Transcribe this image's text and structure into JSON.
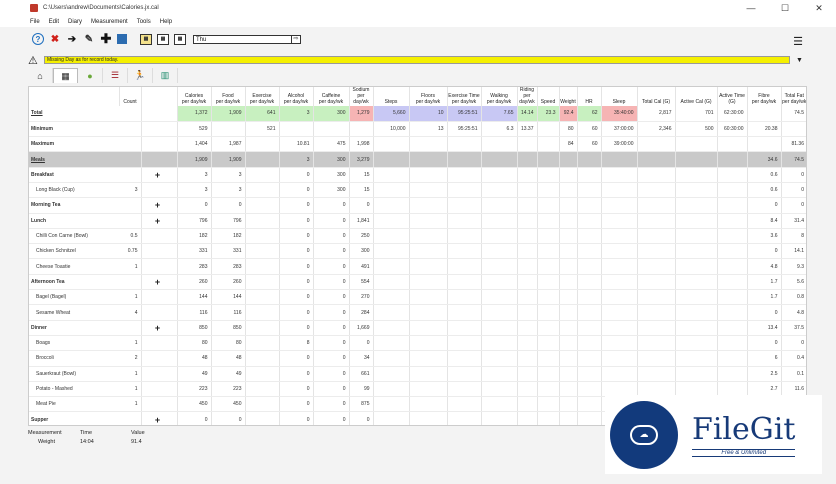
{
  "window": {
    "title": "C:\\Users\\andrew\\Documents\\Calories.jx.cal",
    "minimize": "—",
    "maximize": "☐",
    "close": "✕"
  },
  "menu": [
    "File",
    "Edit",
    "Diary",
    "Measurement",
    "Tools",
    "Help"
  ],
  "toolbar": {
    "day_value": "Thu",
    "go": "⇨",
    "cal1": "▦",
    "cal2": "▦",
    "cal3": "▦"
  },
  "warning": {
    "message": "Missing Day as for record today."
  },
  "tabs": [
    "⌂",
    "▦",
    "●",
    "☰",
    "🏃",
    "▥"
  ],
  "columns": [
    {
      "top": "Calories",
      "bot": "per day/wk"
    },
    {
      "top": "Food",
      "bot": "per day/wk"
    },
    {
      "top": "Exercise",
      "bot": "per day/wk"
    },
    {
      "top": "Alcohol",
      "bot": "per day/wk"
    },
    {
      "top": "Caffeine",
      "bot": "per day/wk"
    },
    {
      "top": "Sodium",
      "bot": "per day/wk"
    },
    {
      "top": "Steps",
      "bot": ""
    },
    {
      "top": "Floors",
      "bot": "per day/wk"
    },
    {
      "top": "Exercise Time",
      "bot": "per day/wk"
    },
    {
      "top": "Walking",
      "bot": "per day/wk"
    },
    {
      "top": "Riding",
      "bot": "per day/wk"
    },
    {
      "top": "Speed",
      "bot": ""
    },
    {
      "top": "Weight",
      "bot": ""
    },
    {
      "top": "HR",
      "bot": ""
    },
    {
      "top": "Sleep",
      "bot": ""
    },
    {
      "top": "Total Cal (G)",
      "bot": ""
    },
    {
      "top": "Active Cal (G)",
      "bot": ""
    },
    {
      "top": "Active Time (G)",
      "bot": ""
    },
    {
      "top": "Fibre",
      "bot": "per day/wk"
    },
    {
      "top": "Total Fat",
      "bot": "per day/wk"
    }
  ],
  "count_header": "Count",
  "rows": [
    {
      "type": "total",
      "label": "Total",
      "count": "",
      "plus": "",
      "vals": [
        "1,372",
        "1,909",
        "641",
        "3",
        "300",
        "1,279",
        "5,660",
        "10",
        "95:25:51",
        "7.65",
        "14.14",
        "23.3",
        "92.4",
        "62",
        "35:40:00",
        "2,817",
        "701",
        "62:30:00",
        "",
        "74.5"
      ],
      "hi": [
        "g",
        "g",
        "g",
        "g",
        "g",
        "r",
        "p",
        "p",
        "p",
        "p",
        "g",
        "g",
        "r",
        "g",
        "r",
        "",
        "",
        "",
        "",
        ""
      ]
    },
    {
      "type": "min",
      "label": "Minimum",
      "count": "",
      "plus": "",
      "vals": [
        "529",
        "",
        "521",
        "",
        "",
        "",
        "10,000",
        "13",
        "95:25:51",
        "6.3",
        "13.37",
        "",
        "80",
        "60",
        "37:00:00",
        "2,346",
        "500",
        "60:30:00",
        "20.38",
        ""
      ]
    },
    {
      "type": "max",
      "label": "Maximum",
      "count": "",
      "plus": "",
      "vals": [
        "1,404",
        "1,987",
        "",
        "10.81",
        "475",
        "1,998",
        "",
        "",
        "",
        "",
        "",
        "",
        "84",
        "60",
        "39:00:00",
        "",
        "",
        "",
        "",
        "81.36"
      ]
    },
    {
      "type": "meals",
      "label": "Meals",
      "count": "",
      "plus": "",
      "vals": [
        "1,909",
        "1,909",
        "",
        "3",
        "300",
        "3,279",
        "",
        "",
        "",
        "",
        "",
        "",
        "",
        "",
        "",
        "",
        "",
        "",
        "34.6",
        "74.5"
      ]
    },
    {
      "type": "sec",
      "label": "Breakfast",
      "count": "",
      "plus": "+",
      "vals": [
        "3",
        "3",
        "",
        "0",
        "300",
        "15",
        "",
        "",
        "",
        "",
        "",
        "",
        "",
        "",
        "",
        "",
        "",
        "",
        "0.6",
        "0"
      ]
    },
    {
      "type": "item",
      "label": "Long Black (Cup)",
      "count": "3",
      "plus": "",
      "vals": [
        "3",
        "3",
        "",
        "0",
        "300",
        "15",
        "",
        "",
        "",
        "",
        "",
        "",
        "",
        "",
        "",
        "",
        "",
        "",
        "0.6",
        "0"
      ]
    },
    {
      "type": "sec",
      "label": "Morning Tea",
      "count": "",
      "plus": "+",
      "vals": [
        "0",
        "0",
        "",
        "0",
        "0",
        "0",
        "",
        "",
        "",
        "",
        "",
        "",
        "",
        "",
        "",
        "",
        "",
        "",
        "0",
        "0"
      ]
    },
    {
      "type": "sec",
      "label": "Lunch",
      "count": "",
      "plus": "+",
      "vals": [
        "796",
        "796",
        "",
        "0",
        "0",
        "1,841",
        "",
        "",
        "",
        "",
        "",
        "",
        "",
        "",
        "",
        "",
        "",
        "",
        "8.4",
        "31.4"
      ]
    },
    {
      "type": "item",
      "label": "Chilli Con Carne (Bowl)",
      "count": "0.5",
      "plus": "",
      "vals": [
        "182",
        "182",
        "",
        "0",
        "0",
        "250",
        "",
        "",
        "",
        "",
        "",
        "",
        "",
        "",
        "",
        "",
        "",
        "",
        "3.6",
        "8"
      ]
    },
    {
      "type": "item",
      "label": "Chicken Schnitzel",
      "count": "0.75",
      "plus": "",
      "vals": [
        "331",
        "331",
        "",
        "0",
        "0",
        "300",
        "",
        "",
        "",
        "",
        "",
        "",
        "",
        "",
        "",
        "",
        "",
        "",
        "0",
        "14.1"
      ]
    },
    {
      "type": "item",
      "label": "Cheese Toastie",
      "count": "1",
      "plus": "",
      "vals": [
        "283",
        "283",
        "",
        "0",
        "0",
        "491",
        "",
        "",
        "",
        "",
        "",
        "",
        "",
        "",
        "",
        "",
        "",
        "",
        "4.8",
        "9.3"
      ]
    },
    {
      "type": "sec",
      "label": "Afternoon Tea",
      "count": "",
      "plus": "+",
      "vals": [
        "260",
        "260",
        "",
        "0",
        "0",
        "554",
        "",
        "",
        "",
        "",
        "",
        "",
        "",
        "",
        "",
        "",
        "",
        "",
        "1.7",
        "5.6"
      ]
    },
    {
      "type": "item",
      "label": "Bagel (Bagel)",
      "count": "1",
      "plus": "",
      "vals": [
        "144",
        "144",
        "",
        "0",
        "0",
        "270",
        "",
        "",
        "",
        "",
        "",
        "",
        "",
        "",
        "",
        "",
        "",
        "",
        "1.7",
        "0.8"
      ]
    },
    {
      "type": "item",
      "label": "Sesame Wheat",
      "count": "4",
      "plus": "",
      "vals": [
        "116",
        "116",
        "",
        "0",
        "0",
        "284",
        "",
        "",
        "",
        "",
        "",
        "",
        "",
        "",
        "",
        "",
        "",
        "",
        "0",
        "4.8"
      ]
    },
    {
      "type": "sec",
      "label": "Dinner",
      "count": "",
      "plus": "+",
      "vals": [
        "850",
        "850",
        "",
        "0",
        "0",
        "1,669",
        "",
        "",
        "",
        "",
        "",
        "",
        "",
        "",
        "",
        "",
        "",
        "",
        "13.4",
        "37.5"
      ]
    },
    {
      "type": "item",
      "label": "Boags",
      "count": "1",
      "plus": "",
      "vals": [
        "80",
        "80",
        "",
        "8",
        "0",
        "0",
        "",
        "",
        "",
        "",
        "",
        "",
        "",
        "",
        "",
        "",
        "",
        "",
        "0",
        "0"
      ]
    },
    {
      "type": "item",
      "label": "Broccoli",
      "count": "2",
      "plus": "",
      "vals": [
        "48",
        "48",
        "",
        "0",
        "0",
        "34",
        "",
        "",
        "",
        "",
        "",
        "",
        "",
        "",
        "",
        "",
        "",
        "",
        "6",
        "0.4"
      ]
    },
    {
      "type": "item",
      "label": "Sauerkraut (Bowl)",
      "count": "1",
      "plus": "",
      "vals": [
        "49",
        "49",
        "",
        "0",
        "0",
        "661",
        "",
        "",
        "",
        "",
        "",
        "",
        "",
        "",
        "",
        "",
        "",
        "",
        "2.5",
        "0.1"
      ]
    },
    {
      "type": "item",
      "label": "Potato - Mashed",
      "count": "1",
      "plus": "",
      "vals": [
        "223",
        "223",
        "",
        "0",
        "0",
        "99",
        "",
        "",
        "",
        "",
        "",
        "",
        "",
        "",
        "",
        "",
        "",
        "",
        "2.7",
        "11.6"
      ]
    },
    {
      "type": "item",
      "label": "Meat Pie",
      "count": "1",
      "plus": "",
      "vals": [
        "450",
        "450",
        "",
        "0",
        "0",
        "875",
        "",
        "",
        "",
        "",
        "",
        "",
        "",
        "",
        "",
        "",
        "",
        "",
        "",
        ""
      ]
    },
    {
      "type": "sec",
      "label": "Supper",
      "count": "",
      "plus": "+",
      "vals": [
        "0",
        "0",
        "",
        "0",
        "0",
        "0",
        "",
        "",
        "",
        "",
        "",
        "",
        "",
        "",
        "",
        "",
        "",
        "",
        "",
        ""
      ]
    }
  ],
  "summary": {
    "headers": [
      "Measurement",
      "Time",
      "Value"
    ],
    "row": [
      "Weight",
      "14:04",
      "91.4"
    ]
  },
  "watermark": {
    "name": "FileGit",
    "tag": "Free & Unlimited"
  }
}
